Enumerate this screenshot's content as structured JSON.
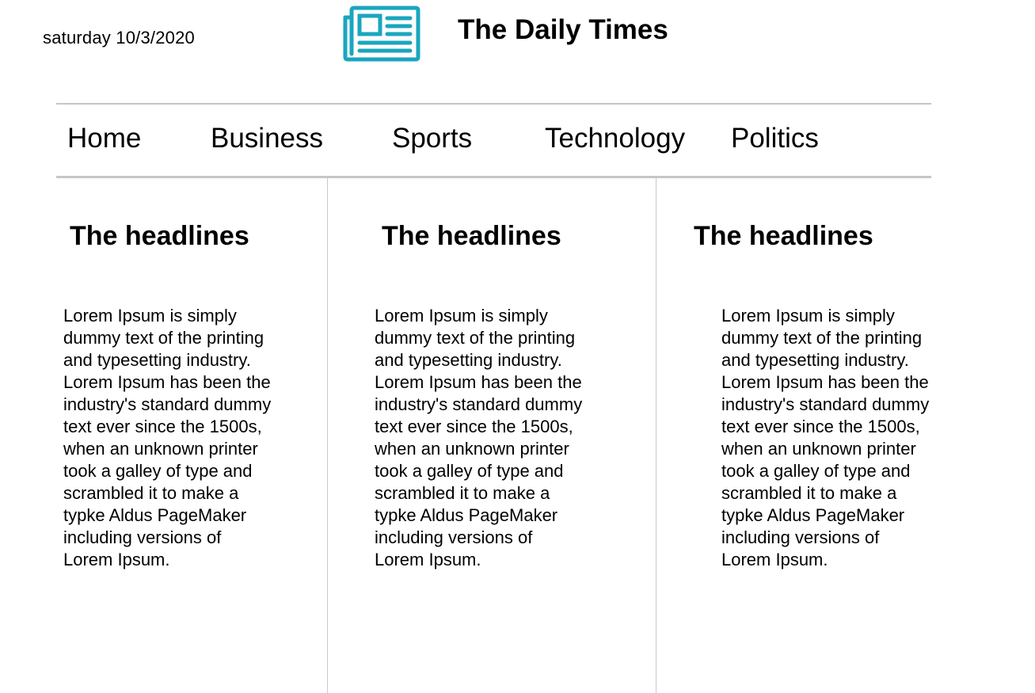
{
  "header": {
    "date": "saturday 10/3/2020",
    "logo_icon": "newspaper-icon",
    "title": "The Daily Times",
    "accent_color": "#1aa6bf"
  },
  "nav": {
    "items": [
      {
        "label": "Home"
      },
      {
        "label": "Business"
      },
      {
        "label": "Sports"
      },
      {
        "label": "Technology"
      },
      {
        "label": "Politics"
      }
    ]
  },
  "columns": [
    {
      "heading": "The headlines",
      "body": "Lorem Ipsum is simply\ndummy text of the printing\nand typesetting industry.\nLorem Ipsum has been the\nindustry's standard dummy\ntext ever since the 1500s,\nwhen an unknown printer\ntook a galley of type and\nscrambled it to make a\ntypke Aldus PageMaker\nincluding versions of\nLorem Ipsum."
    },
    {
      "heading": "The headlines",
      "body": "Lorem Ipsum is simply\ndummy text of the printing\nand typesetting industry.\nLorem Ipsum has been the\nindustry's standard dummy\ntext ever since the 1500s,\nwhen an unknown printer\ntook a galley of type and\nscrambled it to make a\ntypke Aldus PageMaker\nincluding versions of\nLorem Ipsum."
    },
    {
      "heading": "The headlines",
      "body": "Lorem Ipsum is simply\ndummy text of the printing\nand typesetting industry.\nLorem Ipsum has been the\nindustry's standard dummy\ntext ever since the 1500s,\nwhen an unknown printer\ntook a galley of type and\nscrambled it to make a\ntypke Aldus PageMaker\nincluding versions of\nLorem Ipsum."
    }
  ]
}
